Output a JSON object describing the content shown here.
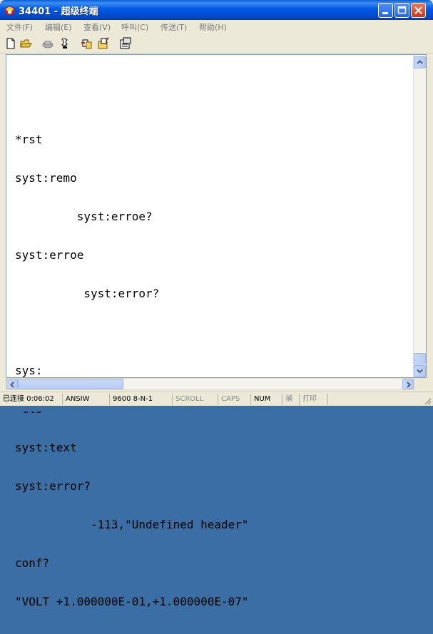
{
  "window": {
    "title": "34401 - 超级终端",
    "icon": "phone-terminal-icon",
    "controls": [
      "minimize-icon",
      "maximize-icon",
      "close-icon"
    ]
  },
  "menu": {
    "items": [
      {
        "label": "文件(F)"
      },
      {
        "label": "编辑(E)"
      },
      {
        "label": "查看(V)"
      },
      {
        "label": "呼叫(C)"
      },
      {
        "label": "传送(T)"
      },
      {
        "label": "帮助(H)"
      }
    ]
  },
  "toolbar": {
    "buttons": [
      "new-icon",
      "open-icon",
      "disconnect-icon",
      "connect-icon",
      "send-icon",
      "receive-icon",
      "properties-icon"
    ]
  },
  "terminal": {
    "lines": [
      "",
      "*rst",
      "syst:remo",
      "         syst:erroe?",
      "syst:erroe",
      "          syst:error?",
      "",
      "sys:",
      "*cls",
      "syst:text",
      "syst:error?",
      "           -113,\"Undefined header\"",
      "conf?",
      "\"VOLT +1.000000E-01,+1.000000E-07\""
    ]
  },
  "status": {
    "connection": "已连接 0:06:02",
    "emulation": "ANSIW",
    "settings": "9600 8-N-1",
    "scroll": "SCROLL",
    "caps": "CAPS",
    "num": "NUM",
    "capture": "捕",
    "print": "打印"
  }
}
